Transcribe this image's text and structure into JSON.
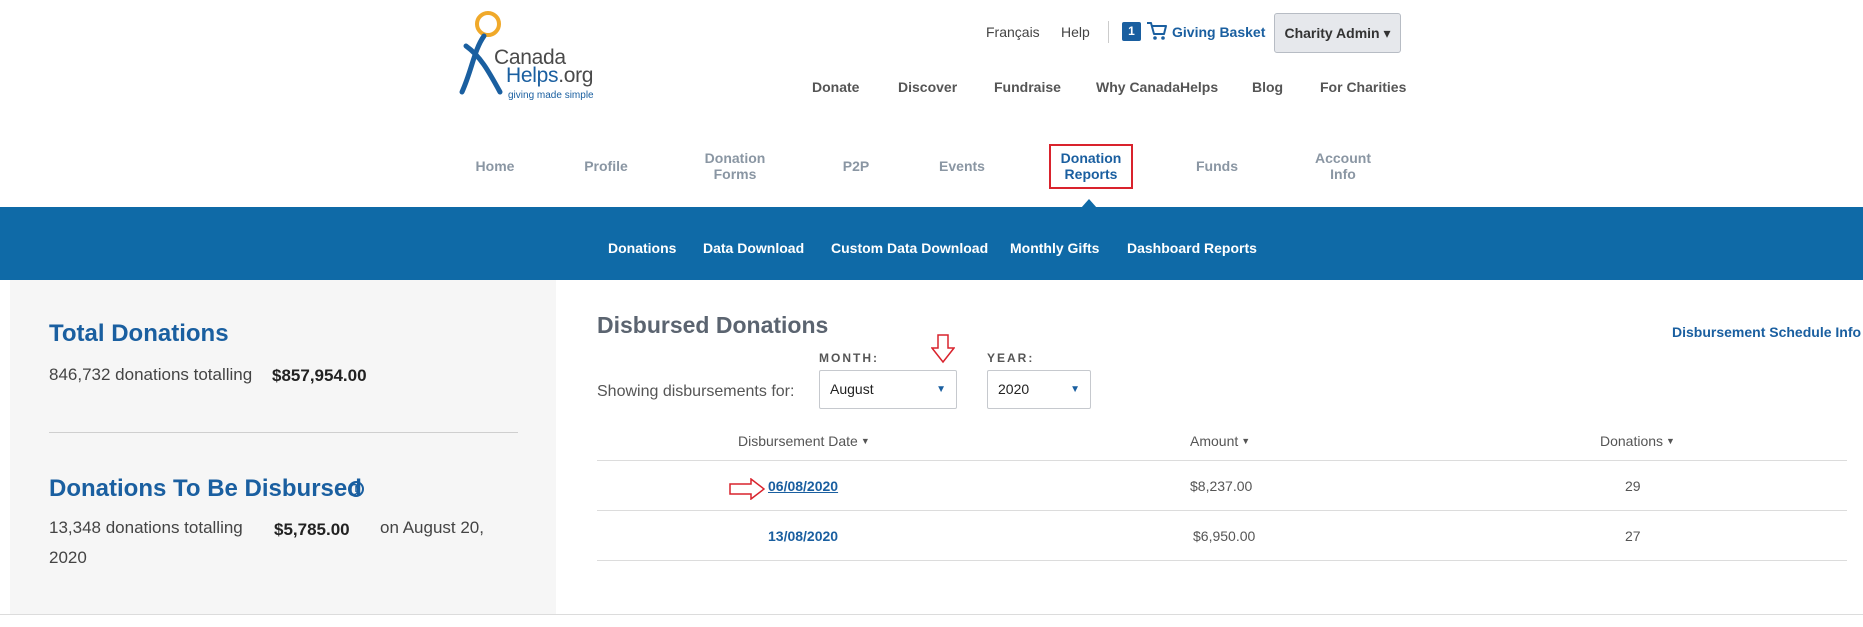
{
  "logo": {
    "line1": "Canada",
    "line2a": "Helps",
    "line2b": ".org",
    "tagline": "giving made simple"
  },
  "utility": {
    "lang": "Français",
    "help": "Help",
    "basket_count": "1",
    "basket_label": "Giving Basket",
    "admin_label": "Charity Admin ▾"
  },
  "main_nav": [
    "Donate",
    "Discover",
    "Fundraise",
    "Why CanadaHelps",
    "Blog",
    "For Charities"
  ],
  "tabs": [
    {
      "l1": "Home",
      "l2": ""
    },
    {
      "l1": "Profile",
      "l2": ""
    },
    {
      "l1": "Donation",
      "l2": "Forms"
    },
    {
      "l1": "P2P",
      "l2": ""
    },
    {
      "l1": "Events",
      "l2": ""
    },
    {
      "l1": "Donation",
      "l2": "Reports"
    },
    {
      "l1": "Funds",
      "l2": ""
    },
    {
      "l1": "Account",
      "l2": "Info"
    }
  ],
  "sub_nav": [
    "Donations",
    "Data Download",
    "Custom Data Download",
    "Monthly Gifts",
    "Dashboard Reports"
  ],
  "total": {
    "title": "Total Donations",
    "text": "846,732 donations totalling",
    "amount": "$857,954.00"
  },
  "to_disburse": {
    "title": "Donations To Be Disbursed",
    "text": "13,348 donations totalling",
    "amount": "$5,785.00",
    "date_line1": "on August 20,",
    "date_line2": "2020"
  },
  "disbursed": {
    "title": "Disbursed Donations",
    "schedule_link": "Disbursement Schedule Info",
    "month_label": "MONTH:",
    "year_label": "YEAR:",
    "showing": "Showing disbursements for:",
    "month_value": "August",
    "year_value": "2020",
    "columns": [
      "Disbursement Date",
      "Amount",
      "Donations"
    ],
    "rows": [
      {
        "date": "06/08/2020",
        "amount": "$8,237.00",
        "donations": "29"
      },
      {
        "date": "13/08/2020",
        "amount": "$6,950.00",
        "donations": "27"
      }
    ]
  },
  "colors": {
    "brand_blue": "#1a5fa0",
    "nav_bar": "#0f6aa7",
    "highlight_red": "#d9232d"
  }
}
